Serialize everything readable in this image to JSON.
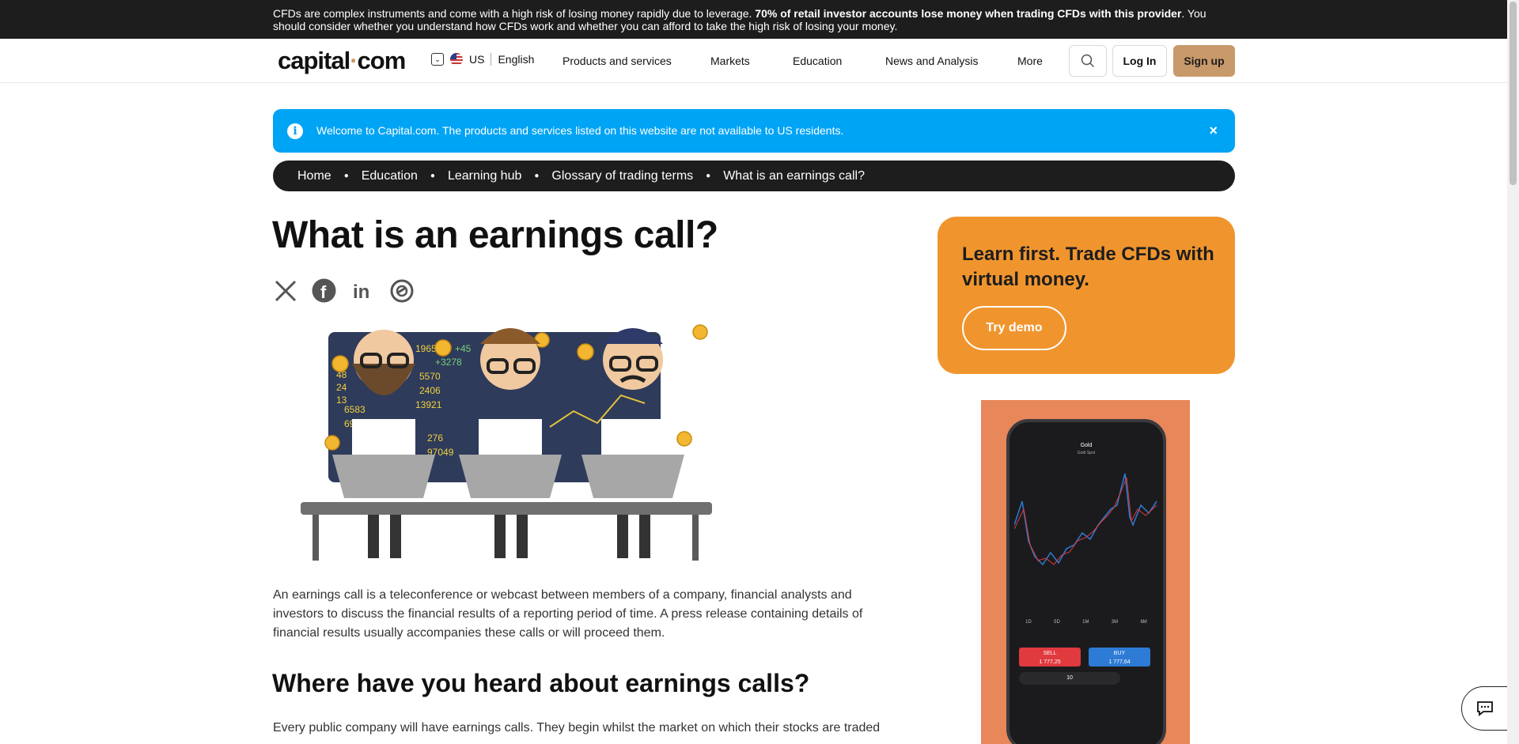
{
  "risk_warning": {
    "prefix": "CFDs are complex instruments and come with a high risk of losing money rapidly due to leverage.",
    "bold": "70% of retail investor accounts lose money when trading CFDs with this provider",
    "suffix": ". You should consider whether you understand how CFDs work and whether you can afford to take the high risk of losing your money."
  },
  "header": {
    "logo_left": "capital",
    "logo_dot": "·",
    "logo_right": "com",
    "region": "US",
    "language": "English",
    "nav": [
      "Products and services",
      "Markets",
      "Education",
      "News and Analysis",
      "More"
    ],
    "login": "Log In",
    "signup": "Sign up"
  },
  "notice": {
    "text": "Welcome to Capital.com. The products and services listed on this website are not available to US residents.",
    "close": "×",
    "info": "i"
  },
  "breadcrumb": [
    "Home",
    "Education",
    "Learning hub",
    "Glossary of trading terms",
    "What is an earnings call?"
  ],
  "article": {
    "title": "What is an earnings call?",
    "intro": "An earnings call is a teleconference or webcast between members of a company, financial analysts and investors to discuss the financial results of a reporting period of time. A press release containing details of financial results usually accompanies these calls or will proceed them.",
    "h2": "Where have you heard about earnings calls?",
    "p2": "Every public company will have earnings calls. They begin whilst the market on which their stocks are traded"
  },
  "hero_screen_numbers": [
    "1965",
    "+45",
    "+3278",
    "5570",
    "2406",
    "13921",
    "6583",
    "69583",
    "276",
    "97049",
    "48",
    "24",
    "13"
  ],
  "promo": {
    "title": "Learn first. Trade CFDs with virtual money.",
    "button": "Try demo"
  },
  "ad_phone": {
    "instrument": "Gold",
    "subtitle": "Gold Spot",
    "sell_label": "SELL",
    "sell_price": "1 777,25",
    "buy_label": "BUY",
    "buy_price": "1 777,64",
    "quantity": "10",
    "timeframes": [
      "1D",
      "5D",
      "1M",
      "3M",
      "6M"
    ]
  },
  "colors": {
    "risk_bar": "#1d1d1d",
    "notice_blue": "#00a4f5",
    "signup_tan": "#c8996a",
    "promo_orange": "#f0952e"
  }
}
